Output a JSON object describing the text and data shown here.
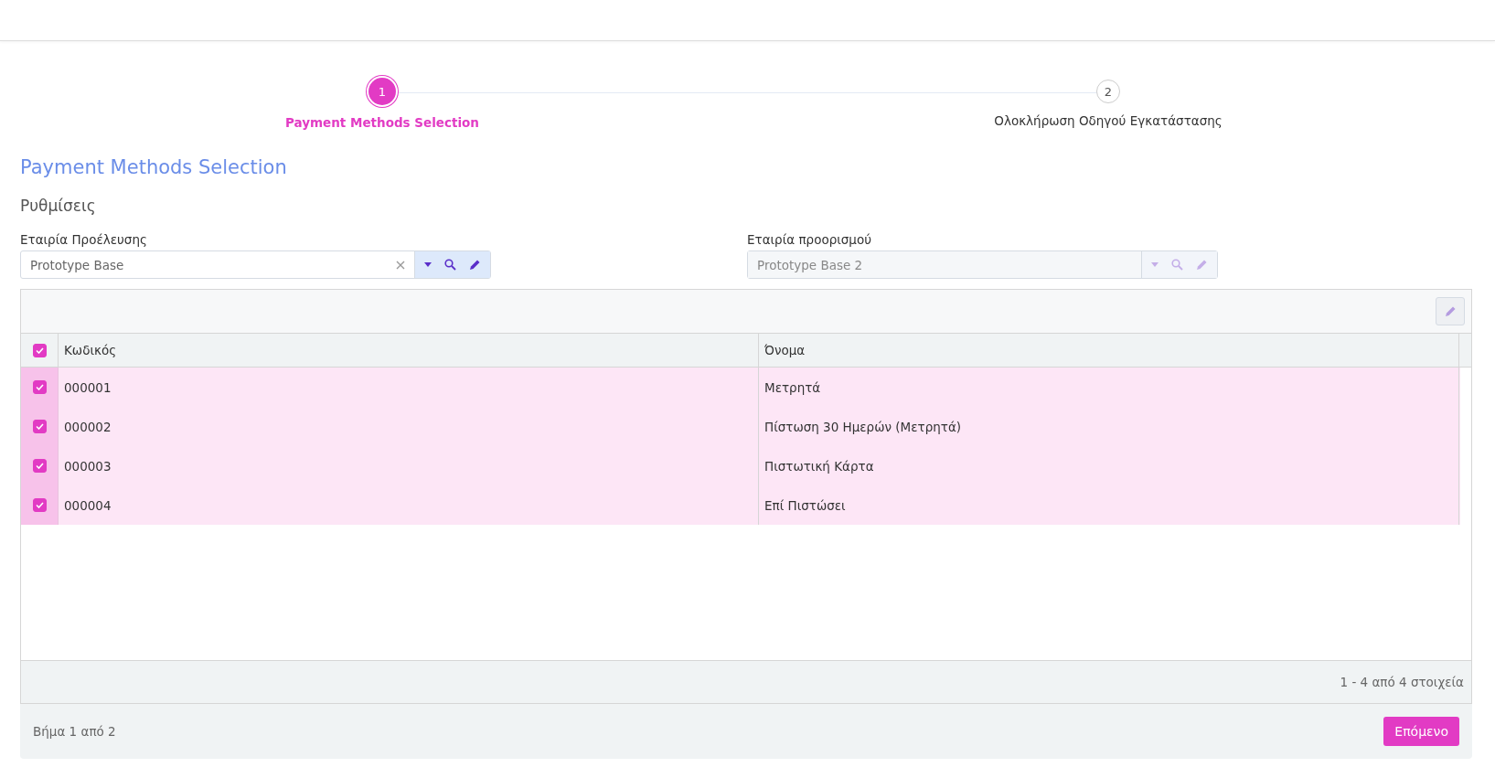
{
  "steps": [
    {
      "number": "1",
      "label": "Payment Methods Selection",
      "selected": true
    },
    {
      "number": "2",
      "label": "Ολοκλήρωση Οδηγού Εγκατάστασης",
      "selected": false
    }
  ],
  "title": "Payment Methods Selection",
  "section": "Ρυθμίσεις",
  "fields": [
    {
      "label": "Εταιρία Προέλευσης",
      "value": "Prototype Base",
      "disabled": false
    },
    {
      "label": "Εταιρία προορισμού",
      "value": "Prototype Base 2",
      "disabled": true
    }
  ],
  "table": {
    "all_checked": true,
    "columns": [
      "Κωδικός",
      "Όνομα"
    ],
    "rows": [
      {
        "code": "000001",
        "name": "Μετρητά",
        "selected": true
      },
      {
        "code": "000002",
        "name": "Πίστωση 30 Ημερών (Μετρητά)",
        "selected": true
      },
      {
        "code": "000003",
        "name": "Πιστωτική Κάρτα",
        "selected": true
      },
      {
        "code": "000004",
        "name": "Επί Πιστώσει",
        "selected": true
      }
    ],
    "pager": "1 - 4 από 4 στοιχεία"
  },
  "footer": {
    "step_text": "Βήμα 1 από 2",
    "next_button": "Επόμενο"
  }
}
